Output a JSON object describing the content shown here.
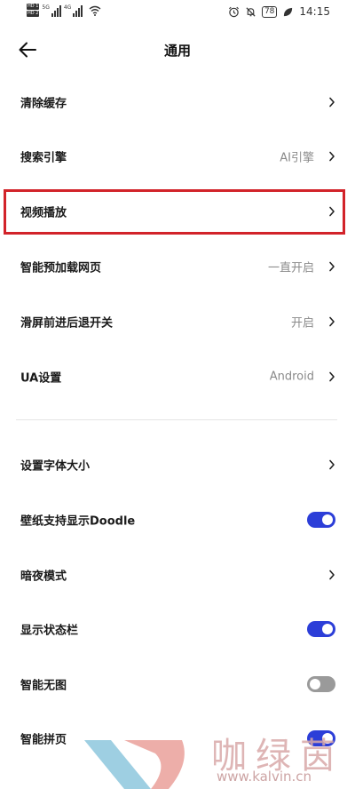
{
  "status_bar": {
    "sim1": "HD 1",
    "sim2": "HD 2",
    "signal1": "5G",
    "signal2": "4G",
    "battery": "78",
    "time": "14:15",
    "icons": [
      "alarm-icon",
      "mute-icon",
      "battery-icon",
      "leaf-icon"
    ]
  },
  "header": {
    "title": "通用"
  },
  "rows": [
    {
      "label": "清除缓存",
      "value": "",
      "control": "chevron"
    },
    {
      "label": "搜索引擎",
      "value": "AI引擎",
      "control": "chevron"
    },
    {
      "label": "视频播放",
      "value": "",
      "control": "chevron"
    },
    {
      "label": "智能预加载网页",
      "value": "一直开启",
      "control": "chevron"
    },
    {
      "label": "滑屏前进后退开关",
      "value": "开启",
      "control": "chevron"
    },
    {
      "label": "UA设置",
      "value": "Android",
      "control": "chevron"
    },
    {
      "label": "设置字体大小",
      "value": "",
      "control": "chevron"
    },
    {
      "label": "壁纸支持显示Doodle",
      "value": "",
      "control": "toggle",
      "on": true
    },
    {
      "label": "暗夜模式",
      "value": "",
      "control": "chevron"
    },
    {
      "label": "显示状态栏",
      "value": "",
      "control": "toggle",
      "on": true
    },
    {
      "label": "智能无图",
      "value": "",
      "control": "toggle",
      "on": false
    },
    {
      "label": "智能拼页",
      "value": "",
      "control": "toggle",
      "on": true
    }
  ],
  "colors": {
    "toggle_on": "#2c3ed8",
    "toggle_off": "#9a9a9a",
    "highlight": "#d2232a"
  },
  "watermark": {
    "text": "咖绿茵",
    "url": "www.kalvin.cn"
  }
}
